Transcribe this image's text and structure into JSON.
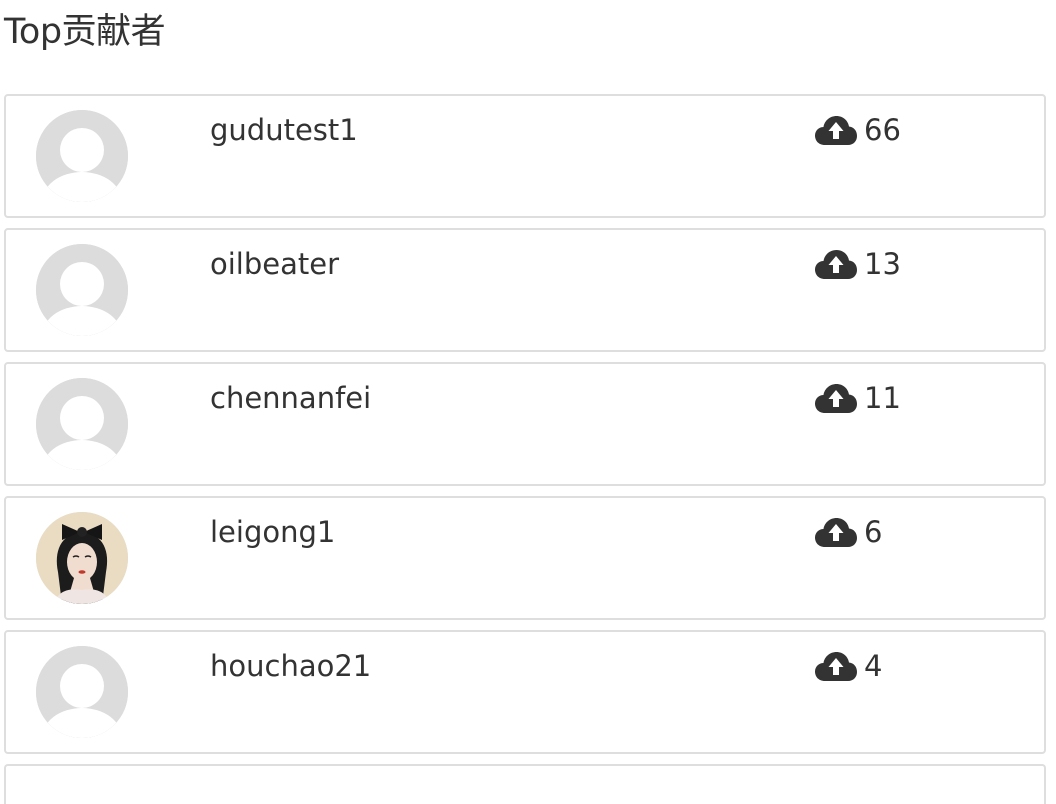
{
  "title": "Top贡献者",
  "contributors": [
    {
      "username": "gudutest1",
      "count": "66",
      "avatar": "default-avatar-icon"
    },
    {
      "username": "oilbeater",
      "count": "13",
      "avatar": "default-avatar-icon"
    },
    {
      "username": "chennanfei",
      "count": "11",
      "avatar": "default-avatar-icon"
    },
    {
      "username": "leigong1",
      "count": "6",
      "avatar": "user-photo"
    },
    {
      "username": "houchao21",
      "count": "4",
      "avatar": "default-avatar-icon"
    }
  ],
  "icons": {
    "count_icon": "cloud-upload-icon"
  },
  "colors": {
    "text": "#333333",
    "card_border": "#dedede",
    "avatar_placeholder": "#dcdcdc",
    "icon": "#333333"
  }
}
